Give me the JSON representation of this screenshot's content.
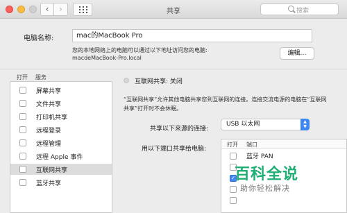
{
  "window": {
    "title": "共享"
  },
  "toolbar": {
    "search_placeholder": "搜索"
  },
  "computer_name": {
    "label": "电脑名称:",
    "value": "mac的MacBook Pro",
    "description": "您的本地网络上的电脑可以通过以下地址访问您的电脑:",
    "local_address": "macdeMacBook-Pro.local",
    "edit_label": "编辑…"
  },
  "services": {
    "header_open": "打开",
    "header_service": "服务",
    "items": [
      {
        "label": "屏幕共享",
        "checked": false
      },
      {
        "label": "文件共享",
        "checked": false
      },
      {
        "label": "打印机共享",
        "checked": false
      },
      {
        "label": "远程登录",
        "checked": false
      },
      {
        "label": "远程管理",
        "checked": false
      },
      {
        "label": "远程 Apple 事件",
        "checked": false
      },
      {
        "label": "互联网共享",
        "checked": false,
        "selected": true
      },
      {
        "label": "蓝牙共享",
        "checked": false
      }
    ]
  },
  "detail": {
    "status": "互联网共享: 关闭",
    "info_line1": "“互联网共享”允许其他电脑共享您到互联网的连接。连接交流电源的电脑在“互联网",
    "info_line2": "共享”打开时不会休眠。",
    "source_label": "共享以下来源的连接:",
    "source_value": "USB 以太网",
    "ports_label": "用以下端口共享给电脑:",
    "ports_header_on": "打开",
    "ports_header_port": "端口",
    "ports": [
      {
        "label": "蓝牙 PAN",
        "checked": false
      },
      {
        "label": "",
        "checked": false
      },
      {
        "label": "",
        "checked": true
      },
      {
        "label": "",
        "checked": false
      },
      {
        "label": "",
        "checked": false
      }
    ]
  },
  "watermark": {
    "title": "百科全说",
    "subtitle": "助你轻松解决"
  },
  "colors": {
    "accent": "#3f86f2",
    "watermark": "#1fae73",
    "selection": "#dcdcdc"
  }
}
